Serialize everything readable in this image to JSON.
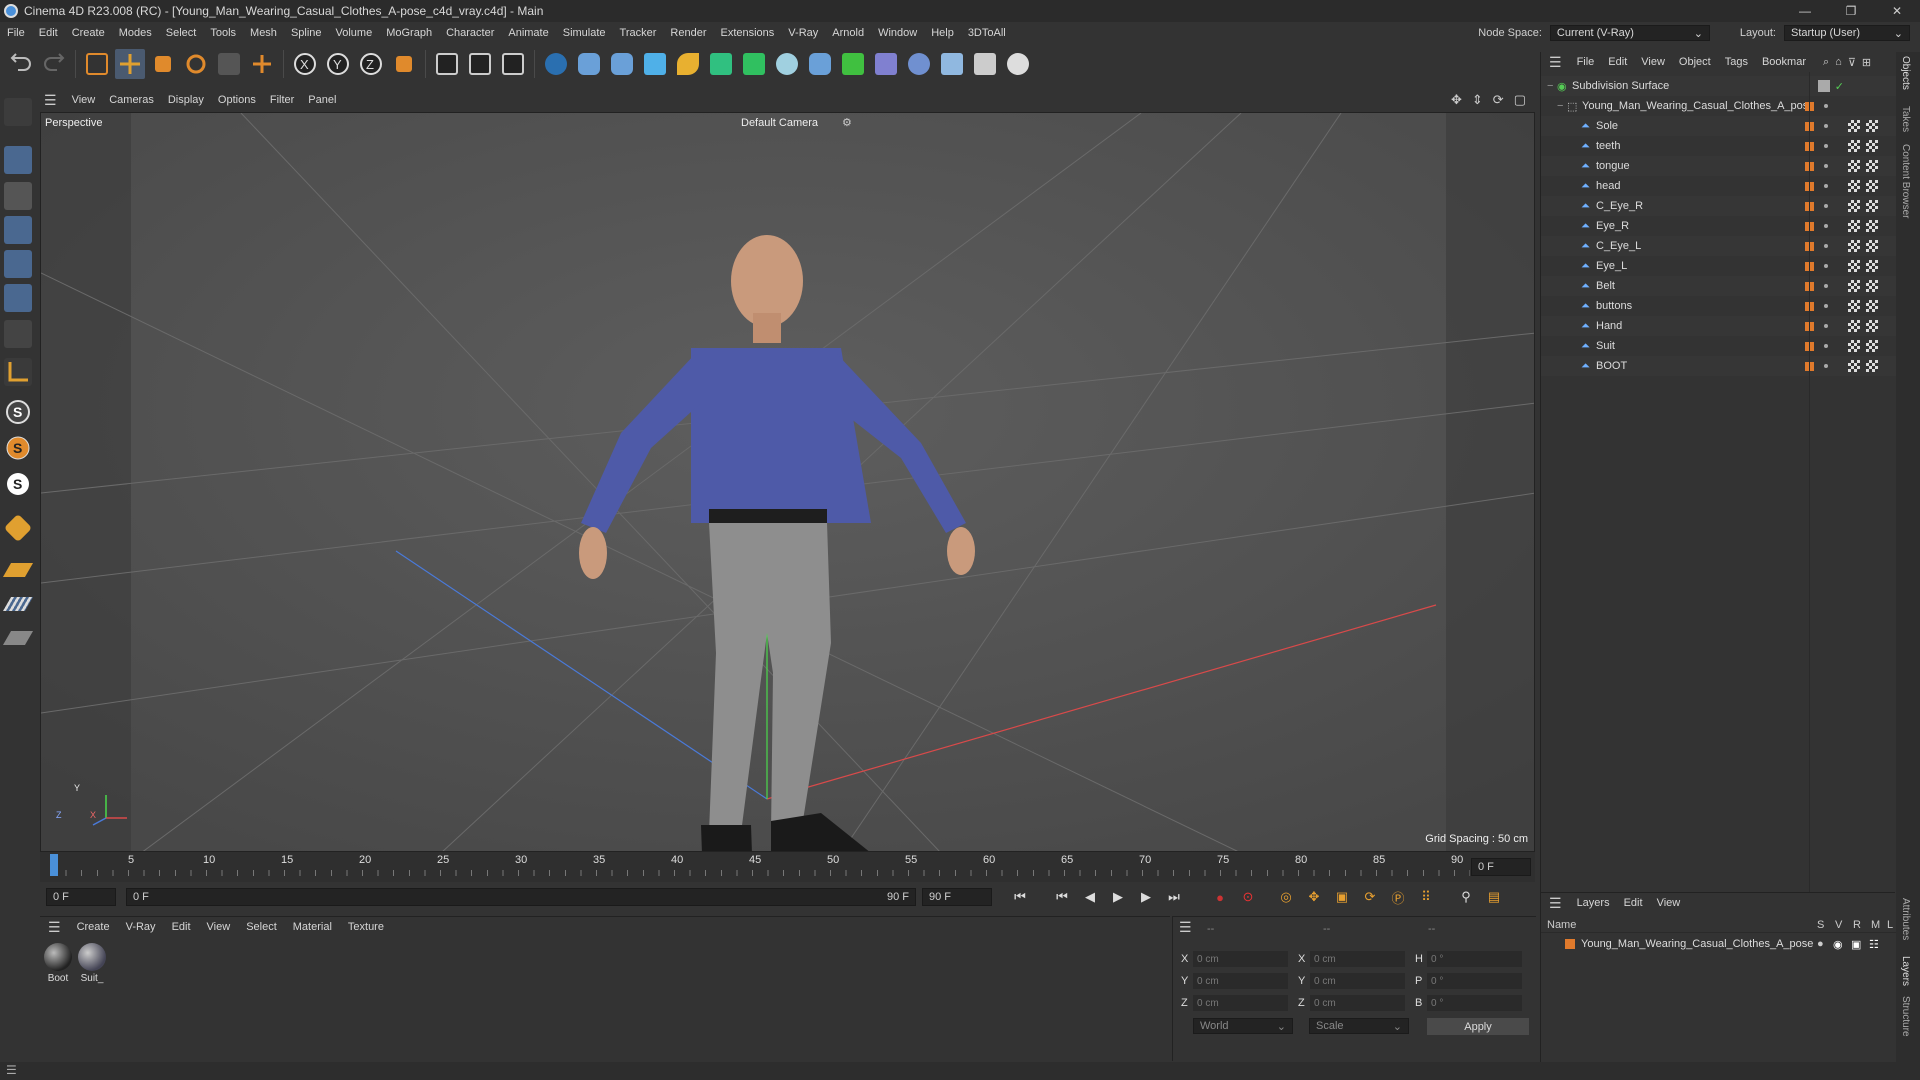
{
  "window": {
    "title": "Cinema 4D R23.008 (RC) - [Young_Man_Wearing_Casual_Clothes_A-pose_c4d_vray.c4d] - Main",
    "minimize": "—",
    "maximize": "❐",
    "close": "✕"
  },
  "menubar": {
    "items": [
      "File",
      "Edit",
      "Create",
      "Modes",
      "Select",
      "Tools",
      "Mesh",
      "Spline",
      "Volume",
      "MoGraph",
      "Character",
      "Animate",
      "Simulate",
      "Tracker",
      "Render",
      "Extensions",
      "V-Ray",
      "Arnold",
      "Window",
      "Help",
      "3DToAll"
    ],
    "node_space_label": "Node Space:",
    "node_space_value": "Current (V-Ray)",
    "layout_label": "Layout:",
    "layout_value": "Startup (User)"
  },
  "viewport": {
    "menu": [
      "View",
      "Cameras",
      "Display",
      "Options",
      "Filter",
      "Panel"
    ],
    "name": "Perspective",
    "camera": "Default Camera",
    "grid_spacing": "Grid Spacing : 50 cm",
    "axis_y": "Y",
    "axis_x": "X",
    "axis_z": "Z"
  },
  "timeline": {
    "ticks": [
      "0",
      "5",
      "10",
      "15",
      "20",
      "25",
      "30",
      "35",
      "40",
      "45",
      "50",
      "55",
      "60",
      "65",
      "70",
      "75",
      "80",
      "85",
      "90"
    ],
    "current_frame": "0 F"
  },
  "transport": {
    "start_field": "0 F",
    "range_start": "0 F",
    "range_end": "90 F",
    "end_field": "90 F"
  },
  "materials": {
    "menu": [
      "Create",
      "V-Ray",
      "Edit",
      "View",
      "Select",
      "Material",
      "Texture"
    ],
    "items": [
      {
        "name": "Boot"
      },
      {
        "name": "Suit_"
      }
    ]
  },
  "coordinates": {
    "header_a": "--",
    "header_b": "--",
    "header_c": "--",
    "rows": [
      {
        "a_label": "X",
        "a_val": "0 cm",
        "b_label": "X",
        "b_val": "0 cm",
        "c_label": "H",
        "c_val": "0 °"
      },
      {
        "a_label": "Y",
        "a_val": "0 cm",
        "b_label": "Y",
        "b_val": "0 cm",
        "c_label": "P",
        "c_val": "0 °"
      },
      {
        "a_label": "Z",
        "a_val": "0 cm",
        "b_label": "Z",
        "b_val": "0 cm",
        "c_label": "B",
        "c_val": "0 °"
      }
    ],
    "mode1": "World",
    "mode2": "Scale",
    "apply": "Apply"
  },
  "objects": {
    "menu": [
      "File",
      "Edit",
      "View",
      "Object",
      "Tags",
      "Bookmar"
    ],
    "root": "Subdivision Surface",
    "group": "Young_Man_Wearing_Casual_Clothes_A_pose",
    "children": [
      "Sole",
      "teeth",
      "tongue",
      "head",
      "C_Eye_R",
      "Eye_R",
      "C_Eye_L",
      "Eye_L",
      "Belt",
      "buttons",
      "Hand",
      "Suit",
      "BOOT"
    ]
  },
  "layers": {
    "menu": [
      "Layers",
      "Edit",
      "View"
    ],
    "col_name": "Name",
    "col_s": "S",
    "col_v": "V",
    "col_r": "R",
    "col_m": "M",
    "col_l": "L",
    "item": "Young_Man_Wearing_Casual_Clothes_A_pose"
  },
  "side_tabs": [
    "Objects",
    "Takes",
    "Content Browser",
    "Attributes",
    "Layers",
    "Structure"
  ],
  "colors": {
    "accent_orange": "#e07a2c",
    "bg_panel": "#333333",
    "viewport_bg": "#5a5a5a",
    "axis_x": "#d94a4a",
    "axis_y": "#4ad94a",
    "axis_z": "#4a7ad9"
  }
}
